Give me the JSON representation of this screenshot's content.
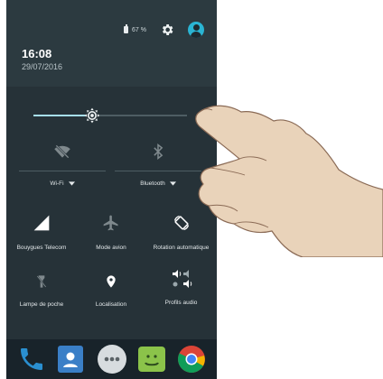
{
  "status_bar": {
    "battery_percent": "67 %",
    "time": "16:08",
    "date": "29/07/2016"
  },
  "brightness": {
    "level": 0.38
  },
  "tiles_row1": [
    {
      "label": "Wi-Fi",
      "icon": "wifi-off-icon"
    },
    {
      "label": "Bluetooth",
      "icon": "bluetooth-icon"
    }
  ],
  "tiles_row2": [
    {
      "label": "Bouygues Telecom",
      "icon": "signal-icon"
    },
    {
      "label": "Mode avion",
      "icon": "airplane-icon"
    },
    {
      "label": "Rotation automatique",
      "icon": "auto-rotate-icon"
    }
  ],
  "tiles_row3": [
    {
      "label": "Lampe de poche",
      "icon": "flashlight-icon"
    },
    {
      "label": "Localisation",
      "icon": "location-icon"
    },
    {
      "label": "Profils audio",
      "icon": "audio-profiles-icon"
    }
  ],
  "dock": [
    {
      "icon": "phone-icon"
    },
    {
      "icon": "contacts-icon"
    },
    {
      "icon": "app-drawer-icon"
    },
    {
      "icon": "messaging-icon"
    },
    {
      "icon": "chrome-icon"
    }
  ],
  "colors": {
    "accent": "#a7dff0",
    "avatar": "#2ab4d3",
    "panel": "#263238",
    "status_bg": "#2c3a40"
  }
}
